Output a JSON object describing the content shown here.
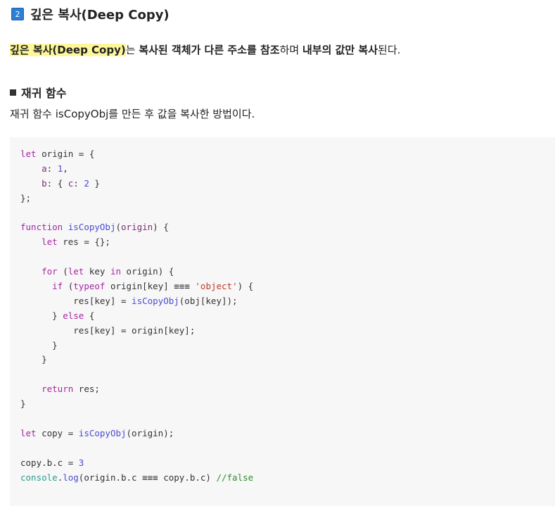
{
  "section": {
    "number": "2",
    "title": "깊은 복사(Deep Copy)"
  },
  "intro": {
    "term": "깊은 복사(Deep Copy)",
    "particle": "는 ",
    "phrase1": "복사된 객체가 다른 주소를 참조",
    "text1": "하며 ",
    "phrase2": "내부의 값만 복사",
    "text2": "된다."
  },
  "subsection": {
    "title": "재귀 함수",
    "description": "재귀 함수 isCopyObj를 만든 후 값을 복사한 방법이다."
  },
  "code": {
    "lines": [
      [
        {
          "t": "let",
          "c": "kw"
        },
        {
          "t": " origin = {"
        }
      ],
      [
        {
          "t": "    "
        },
        {
          "t": "a",
          "c": "prop"
        },
        {
          "t": ": "
        },
        {
          "t": "1",
          "c": "num"
        },
        {
          "t": ","
        }
      ],
      [
        {
          "t": "    "
        },
        {
          "t": "b",
          "c": "prop"
        },
        {
          "t": ": { "
        },
        {
          "t": "c",
          "c": "prop"
        },
        {
          "t": ": "
        },
        {
          "t": "2",
          "c": "num"
        },
        {
          "t": " }"
        }
      ],
      [
        {
          "t": "};"
        }
      ],
      [],
      [
        {
          "t": "function",
          "c": "kw"
        },
        {
          "t": " "
        },
        {
          "t": "isCopyObj",
          "c": "fn"
        },
        {
          "t": "("
        },
        {
          "t": "origin",
          "c": "prop"
        },
        {
          "t": ") {"
        }
      ],
      [
        {
          "t": "    "
        },
        {
          "t": "let",
          "c": "kw"
        },
        {
          "t": " res = {};"
        }
      ],
      [],
      [
        {
          "t": "    "
        },
        {
          "t": "for",
          "c": "kw"
        },
        {
          "t": " ("
        },
        {
          "t": "let",
          "c": "kw"
        },
        {
          "t": " key "
        },
        {
          "t": "in",
          "c": "kw"
        },
        {
          "t": " origin) {"
        }
      ],
      [
        {
          "t": "      "
        },
        {
          "t": "if",
          "c": "kw"
        },
        {
          "t": " ("
        },
        {
          "t": "typeof",
          "c": "kw"
        },
        {
          "t": " origin[key] "
        },
        {
          "t": "≡≡≡"
        },
        {
          "t": " "
        },
        {
          "t": "'object'",
          "c": "str"
        },
        {
          "t": ") {"
        }
      ],
      [
        {
          "t": "          res[key] = "
        },
        {
          "t": "isCopyObj",
          "c": "fn"
        },
        {
          "t": "(obj[key]);"
        }
      ],
      [
        {
          "t": "      } "
        },
        {
          "t": "else",
          "c": "kw"
        },
        {
          "t": " {"
        }
      ],
      [
        {
          "t": "          res[key] = origin[key];"
        }
      ],
      [
        {
          "t": "      }"
        }
      ],
      [
        {
          "t": "    }"
        }
      ],
      [],
      [
        {
          "t": "    "
        },
        {
          "t": "return",
          "c": "kw"
        },
        {
          "t": " res;"
        }
      ],
      [
        {
          "t": "}"
        }
      ],
      [],
      [
        {
          "t": "let",
          "c": "kw"
        },
        {
          "t": " copy = "
        },
        {
          "t": "isCopyObj",
          "c": "fn"
        },
        {
          "t": "(origin);"
        }
      ],
      [],
      [
        {
          "t": "copy.b.c = "
        },
        {
          "t": "3",
          "c": "num"
        }
      ],
      [
        {
          "t": "console",
          "c": "builtin"
        },
        {
          "t": "."
        },
        {
          "t": "log",
          "c": "fn"
        },
        {
          "t": "(origin.b.c "
        },
        {
          "t": "≡≡≡"
        },
        {
          "t": " copy.b.c) "
        },
        {
          "t": "//false",
          "c": "cm"
        }
      ]
    ]
  }
}
